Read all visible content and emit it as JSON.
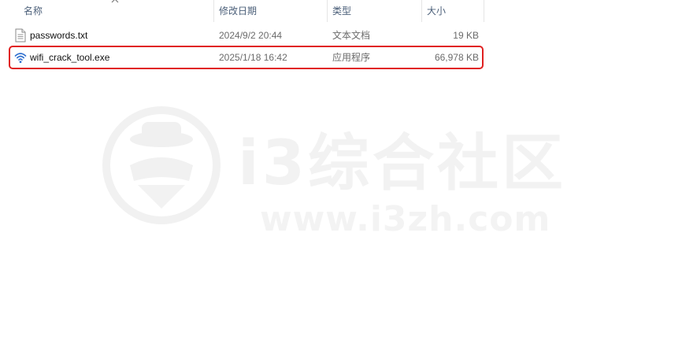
{
  "columns": {
    "name": "名称",
    "modified": "修改日期",
    "type": "类型",
    "size": "大小"
  },
  "files": [
    {
      "name": "passwords.txt",
      "modified": "2024/9/2 20:44",
      "type": "文本文档",
      "size": "19 KB",
      "icon": "text-file-icon"
    },
    {
      "name": "wifi_crack_tool.exe",
      "modified": "2025/1/18 16:42",
      "type": "应用程序",
      "size": "66,978 KB",
      "icon": "wifi-icon"
    }
  ],
  "watermark": {
    "title": "i3综合社区",
    "url": "www.i3zh.com"
  },
  "colors": {
    "highlight_border": "#e02020",
    "header_text": "#4c607a",
    "wifi_icon": "#2f6fcf"
  }
}
